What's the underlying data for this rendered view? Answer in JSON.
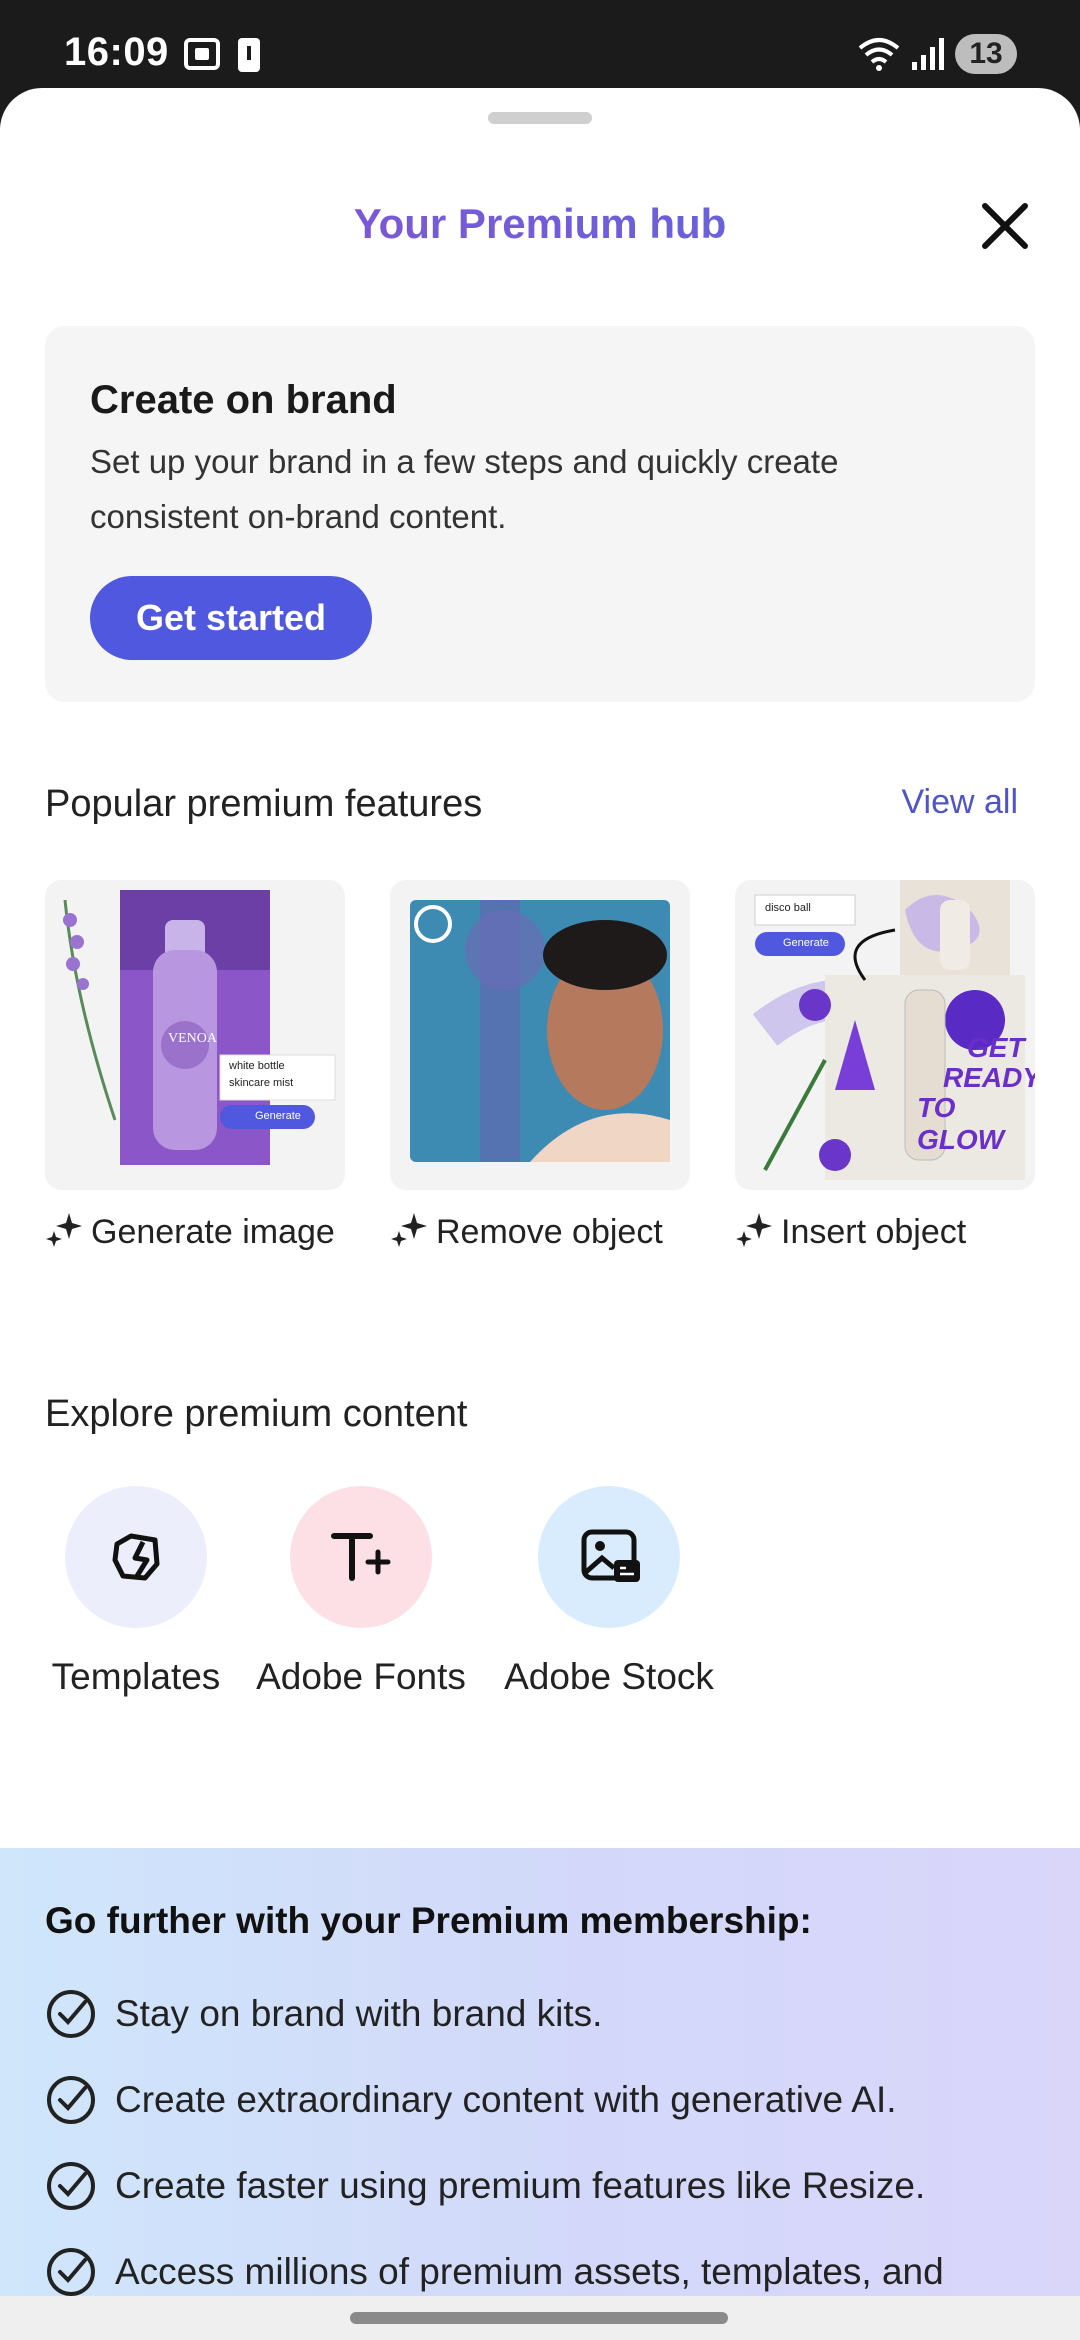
{
  "status_bar": {
    "time": "16:09",
    "battery_level": "13"
  },
  "sheet": {
    "title": "Your Premium hub"
  },
  "brand_card": {
    "title": "Create on brand",
    "description": "Set up your brand in a few steps and quickly create consistent on-brand content.",
    "button_label": "Get started"
  },
  "popular": {
    "heading": "Popular premium features",
    "view_all": "View all",
    "features": [
      {
        "label": "Generate image",
        "icon": "sparkle-icon",
        "thumb": {
          "brand": "VENOA",
          "prompt_line1": "white bottle",
          "prompt_line2": "skincare mist",
          "button": "Generate"
        }
      },
      {
        "label": "Remove object",
        "icon": "sparkle-icon"
      },
      {
        "label": "Insert object",
        "icon": "sparkle-icon",
        "thumb": {
          "prompt": "disco ball",
          "button": "Generate",
          "overlay_line1": "GET",
          "overlay_line2": "READY",
          "overlay_line3": "TO GLOW"
        }
      }
    ]
  },
  "explore": {
    "heading": "Explore premium content",
    "items": [
      {
        "label": "Templates",
        "icon": "templates-icon",
        "color": "#eceefb"
      },
      {
        "label": "Adobe Fonts",
        "icon": "fonts-icon",
        "color": "#fde0e6"
      },
      {
        "label": "Adobe Stock",
        "icon": "stock-icon",
        "color": "#d9ecfd"
      }
    ]
  },
  "membership": {
    "title": "Go further with your Premium membership:",
    "benefits": [
      "Stay on brand with brand kits.",
      "Create extraordinary content with generative AI.",
      "Create faster using premium features like Resize.",
      "Access millions of premium assets, templates, and"
    ]
  }
}
